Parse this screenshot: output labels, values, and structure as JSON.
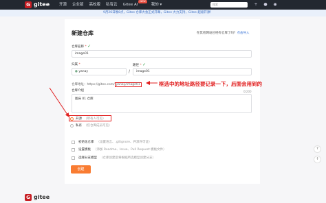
{
  "topbar": {
    "logo_letter": "G",
    "logo_text": "gitee",
    "nav": [
      "开源",
      "企业版",
      "高校版",
      "私有云",
      "Gitee AI",
      "我的 ▾"
    ],
    "new_badge": "NEW",
    "search_placeholder": "搜索"
  },
  "notice": "9月26日晚8点，Gitee 仓库大会正式开幕，Gitee 大力支持，Gitee 超级开源！",
  "form": {
    "title": "新建仓库",
    "import_text": "在其他网站已经有仓库了吗？",
    "import_link": "点击导入",
    "repo_name_label": "仓库名称",
    "repo_name_value": "image01",
    "owner_label": "归属",
    "owner_value": "yanay",
    "path_label": "路径",
    "path_value": "image01",
    "url_prefix": "仓库地址：https://gitee.com/",
    "url_highlight": "yanay/image01",
    "desc_label": "仓库介绍",
    "desc_counter": "0/200",
    "desc_value": "图床 01 仓库",
    "radio_open": "开源",
    "radio_open_hint": "（所有人可见）",
    "radio_private": "私有",
    "radio_private_hint": "（仅仓库成员可见）",
    "init_repo": "初始化仓库",
    "init_repo_hint": "（设置语言、.gitignore、开源许可证）",
    "set_template": "设置模板",
    "set_template_hint": "（添加 Readme、Issue、Pull Request 模板文件）",
    "branch_model": "选择分支模型",
    "branch_model_hint": "（仓库创建后将根据所选模型创建分支）",
    "create_button": "创建"
  },
  "annotation": "框选中的地址路径要记录一下，后面会用到的",
  "footer_logo_text": "gitee",
  "colors": {
    "accent": "#f97c32",
    "brand": "#c71d23",
    "annotation": "#e11f1f"
  }
}
